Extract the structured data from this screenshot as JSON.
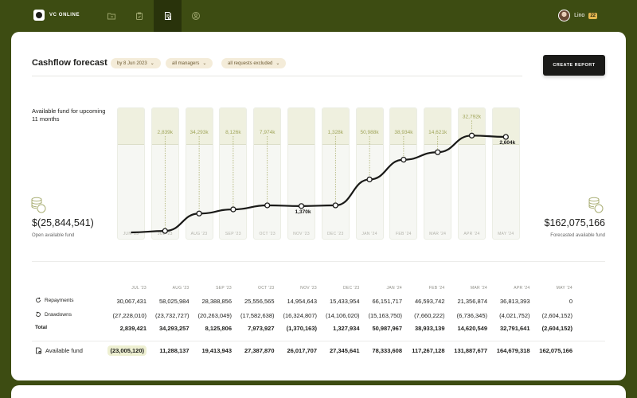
{
  "app": {
    "name": "VC ONLINE"
  },
  "user": {
    "name": "Lino",
    "badge": "22"
  },
  "header": {
    "title": "Cashflow forecast",
    "filters": [
      "by 8 Jun 2023",
      "all managers",
      "all requests excluded"
    ],
    "create_report": "CREATE REPORT"
  },
  "summary": {
    "available_label": "Available fund for upcoming 11 months",
    "open_value": "$(25,844,541)",
    "open_label": "Open available fund",
    "forecast_value": "$162,075,166",
    "forecast_label": "Forecasted available fund"
  },
  "chart_data": {
    "type": "line",
    "categories": [
      "JUN '23",
      "JUL '23",
      "AUG '23",
      "SEP '23",
      "OCT '23",
      "NOV '23",
      "DEC '23",
      "JAN '24",
      "FEB '24",
      "MAR '24",
      "APR '24",
      "MAY '24"
    ],
    "point_labels": [
      "",
      "2,839k",
      "34,293k",
      "8,126k",
      "7,974k",
      "1,370k",
      "1,328k",
      "50,988k",
      "38,934k",
      "14,621k",
      "32,792k",
      "2,604k"
    ],
    "values": [
      -25845,
      -23005,
      11288,
      19414,
      27388,
      26018,
      27346,
      78334,
      117267,
      131888,
      164679,
      162075
    ],
    "ylim": [
      -40000,
      220000
    ],
    "accent": "#a0a55a"
  },
  "table": {
    "columns": [
      "JUL '23",
      "AUG '23",
      "SEP '23",
      "OCT '23",
      "NOV '23",
      "DEC '23",
      "JAN '24",
      "FEB '24",
      "MAR '24",
      "APR '24",
      "MAY '24"
    ],
    "rows": [
      {
        "label": "Repayments",
        "icon": "refresh-icon",
        "values": [
          "30,067,431",
          "58,025,984",
          "28,388,856",
          "25,556,565",
          "14,954,643",
          "15,433,954",
          "66,151,717",
          "46,593,742",
          "21,356,874",
          "36,813,393",
          "0"
        ]
      },
      {
        "label": "Drawdowns",
        "icon": "reload-icon",
        "values": [
          "(27,228,010)",
          "(23,732,727)",
          "(20,263,049)",
          "(17,582,638)",
          "(16,324,807)",
          "(14,106,020)",
          "(15,163,750)",
          "(7,660,222)",
          "(6,736,345)",
          "(4,021,752)",
          "(2,604,152)"
        ]
      },
      {
        "label": "Total",
        "values": [
          "2,839,421",
          "34,293,257",
          "8,125,806",
          "7,973,927",
          "(1,370,163)",
          "1,327,934",
          "50,987,967",
          "38,933,139",
          "14,620,549",
          "32,791,641",
          "(2,604,152)"
        ]
      }
    ],
    "available": {
      "label": "Available fund",
      "values": [
        "(23,005,120)",
        "11,288,137",
        "19,413,943",
        "27,387,870",
        "26,017,707",
        "27,345,641",
        "78,333,608",
        "117,267,128",
        "131,887,677",
        "164,679,318",
        "162,075,166"
      ]
    }
  }
}
